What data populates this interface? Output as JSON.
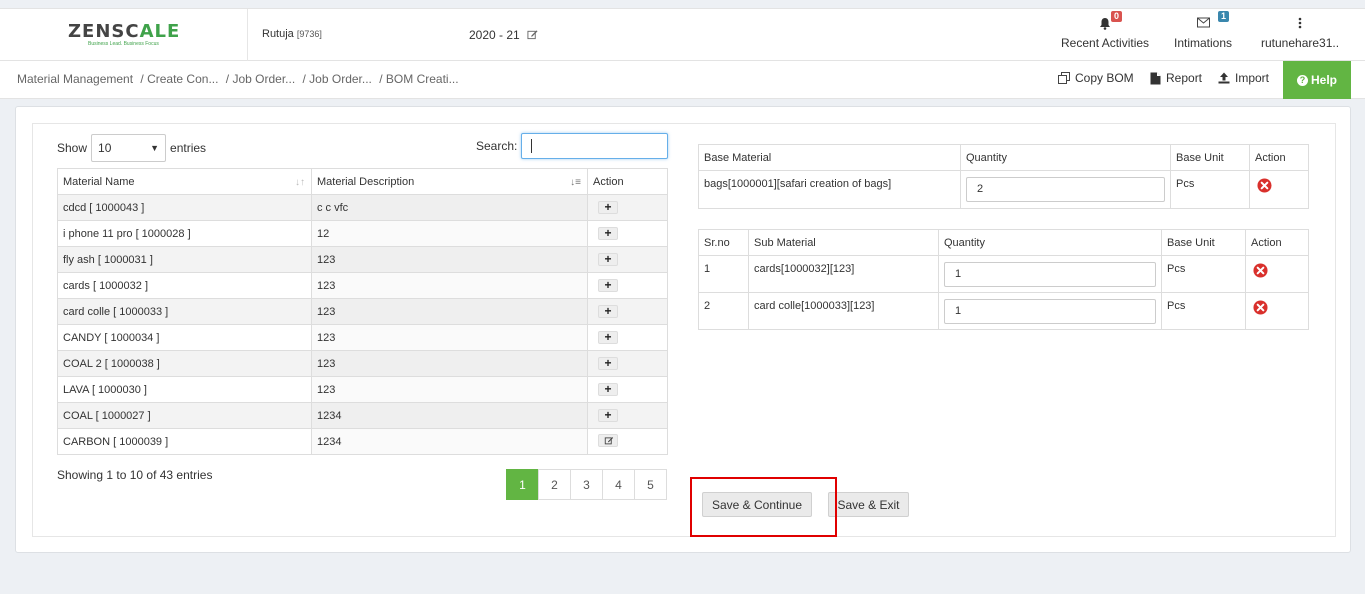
{
  "header": {
    "logo": {
      "text_a": "ZENSC",
      "text_b": "ALE",
      "tagline": "Business Lead. Business Focus"
    },
    "user_name": "Rutuja",
    "user_id": "[9736]",
    "financial_year": "2020 - 21",
    "recent_activities": {
      "label": "Recent Activities",
      "count": "0"
    },
    "intimations": {
      "label": "Intimations",
      "count": "1"
    },
    "account": {
      "label": "rutunehare31.."
    }
  },
  "breadcrumb": {
    "items": [
      "Material Management",
      "/ Create Con...",
      "/ Job Order...",
      "/ Job Order...",
      "/ BOM Creati..."
    ]
  },
  "toolbar": {
    "copy_bom": "Copy BOM",
    "report": "Report",
    "import": "Import",
    "help": "Help"
  },
  "list": {
    "show_label": "Show",
    "entries_value": "10",
    "entries_label": "entries",
    "search_label": "Search:",
    "search_value": "",
    "columns": {
      "name": "Material Name",
      "description": "Material Description",
      "action": "Action"
    },
    "rows": [
      {
        "name": "cdcd [ 1000043 ]",
        "description": "c c vfc",
        "action": "add"
      },
      {
        "name": "i phone 11 pro [ 1000028 ]",
        "description": "12",
        "action": "add"
      },
      {
        "name": "fly ash [ 1000031 ]",
        "description": "123",
        "action": "add"
      },
      {
        "name": "cards [ 1000032 ]",
        "description": "123",
        "action": "add"
      },
      {
        "name": "card colle [ 1000033 ]",
        "description": "123",
        "action": "add"
      },
      {
        "name": "CANDY [ 1000034 ]",
        "description": "123",
        "action": "add"
      },
      {
        "name": "COAL 2 [ 1000038 ]",
        "description": "123",
        "action": "add"
      },
      {
        "name": "LAVA [ 1000030 ]",
        "description": "123",
        "action": "add"
      },
      {
        "name": "COAL [ 1000027 ]",
        "description": "1234",
        "action": "add"
      },
      {
        "name": "CARBON [ 1000039 ]",
        "description": "1234",
        "action": "edit"
      }
    ],
    "summary": "Showing 1 to 10 of 43 entries",
    "pages": [
      "1",
      "2",
      "3",
      "4",
      "5"
    ],
    "active_page": "1"
  },
  "base_material": {
    "columns": {
      "material": "Base Material",
      "quantity": "Quantity",
      "unit": "Base Unit",
      "action": "Action"
    },
    "row": {
      "material": "bags[1000001][safari creation of bags]",
      "quantity": "2",
      "unit": "Pcs"
    }
  },
  "sub_materials": {
    "columns": {
      "srno": "Sr.no",
      "material": "Sub Material",
      "quantity": "Quantity",
      "unit": "Base Unit",
      "action": "Action"
    },
    "rows": [
      {
        "srno": "1",
        "material": "cards[1000032][123]",
        "quantity": "1",
        "unit": "Pcs"
      },
      {
        "srno": "2",
        "material": "card colle[1000033][123]",
        "quantity": "1",
        "unit": "Pcs"
      }
    ]
  },
  "actions": {
    "save_continue": "Save & Continue",
    "save_exit": "Save & Exit"
  },
  "colors": {
    "accent_green": "#62b543",
    "delete_red": "#d9302c",
    "highlight_red": "#e00000"
  }
}
